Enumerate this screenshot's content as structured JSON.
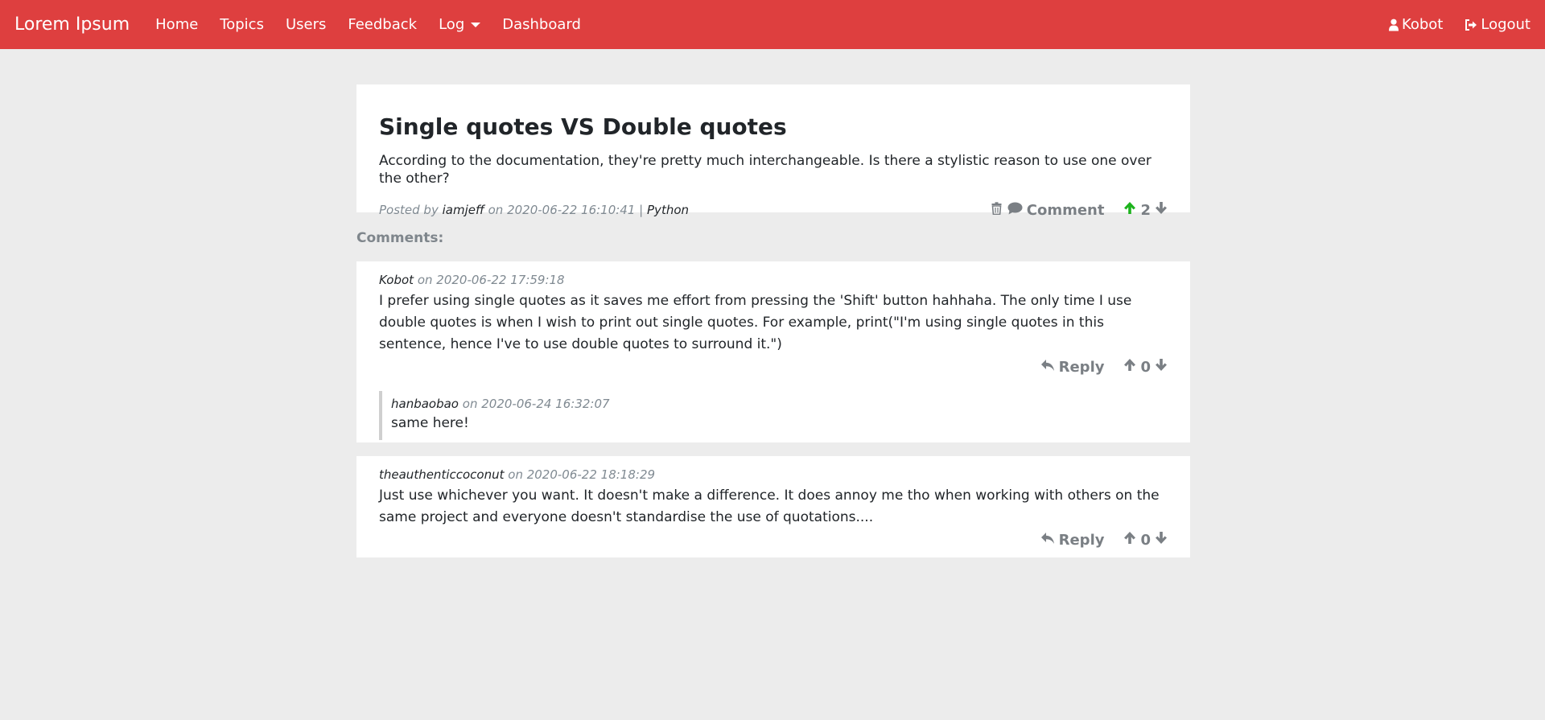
{
  "nav": {
    "brand": "Lorem Ipsum",
    "links": [
      "Home",
      "Topics",
      "Users",
      "Feedback",
      "Log",
      "Dashboard"
    ],
    "user": "Kobot",
    "logout": "Logout"
  },
  "post": {
    "title": "Single quotes VS Double quotes",
    "body": "According to the documentation, they're pretty much interchangeable. Is there a stylistic reason to use one over the other?",
    "posted_by_label": "Posted by",
    "author": "iamjeff",
    "on_label": "on",
    "date": "2020-06-22 16:10:41",
    "separator": "|",
    "topic": "Python",
    "comment_label": "Comment",
    "votes": "2"
  },
  "comments_label": "Comments:",
  "comments": [
    {
      "author": "Kobot",
      "date_label": "on 2020-06-22 17:59:18",
      "body": "I prefer using single quotes as it saves me effort from pressing the 'Shift' button hahhaha. The only time I use double quotes is when I wish to print out single quotes. For example, print(\"I'm using single quotes in this sentence, hence I've to use double quotes to surround it.\")",
      "reply_label": "Reply",
      "votes": "0",
      "replies": [
        {
          "author": "hanbaobao",
          "date_label": "on 2020-06-24 16:32:07",
          "body": "same here!"
        }
      ]
    },
    {
      "author": "theauthenticcoconut",
      "date_label": "on 2020-06-22 18:18:29",
      "body": "Just use whichever you want. It doesn't make a difference. It does annoy me tho when working with others on the same project and everyone doesn't standardise the use of quotations....",
      "reply_label": "Reply",
      "votes": "0"
    }
  ],
  "colors": {
    "navbar": "#de3f3f",
    "background": "#ececec",
    "upvote_active": "#1db31d",
    "muted": "#7a7f84"
  },
  "icons": [
    "user-icon",
    "sign-out-icon",
    "trash-icon",
    "comment-icon",
    "arrow-up-icon",
    "arrow-down-icon",
    "reply-icon"
  ]
}
